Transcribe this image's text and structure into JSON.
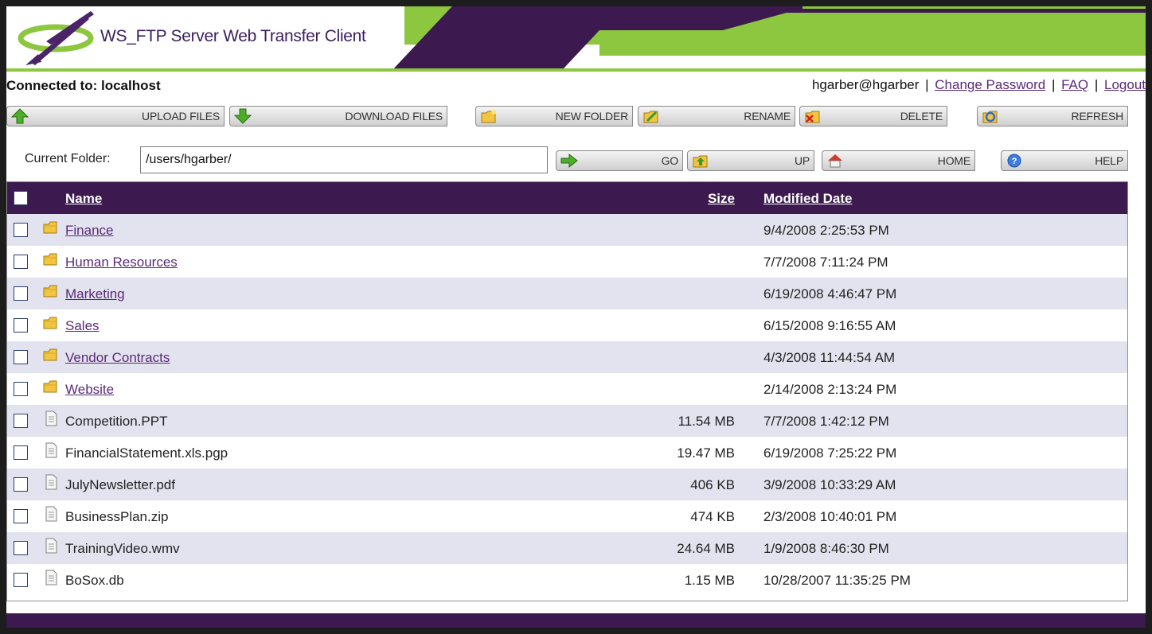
{
  "header": {
    "app_title": "WS_FTP Server Web Transfer Client",
    "colors": {
      "purple": "#3c1a4f",
      "green": "#8dc63f"
    }
  },
  "status": {
    "connected": "Connected to: localhost",
    "user": "hgarber@hgarber",
    "separator": "|",
    "change_password": "Change Password",
    "faq": "FAQ",
    "logout": "Logout"
  },
  "toolbar": {
    "upload": {
      "label": "UPLOAD FILES",
      "icon": "green-up-arrow-icon"
    },
    "download": {
      "label": "DOWNLOAD FILES",
      "icon": "green-down-arrow-icon"
    },
    "new_folder": {
      "label": "NEW FOLDER",
      "icon": "new-folder-icon"
    },
    "rename": {
      "label": "RENAME",
      "icon": "rename-icon"
    },
    "delete": {
      "label": "DELETE",
      "icon": "delete-icon"
    },
    "refresh": {
      "label": "REFRESH",
      "icon": "refresh-icon"
    }
  },
  "navbar": {
    "current_folder_label": "Current Folder:",
    "current_folder_value": "/users/hgarber/",
    "go": {
      "label": "GO",
      "icon": "green-right-arrow-icon"
    },
    "up": {
      "label": "UP",
      "icon": "up-folder-icon"
    },
    "home": {
      "label": "HOME",
      "icon": "home-icon"
    },
    "help": {
      "label": "HELP",
      "icon": "help-icon"
    }
  },
  "table": {
    "columns": {
      "name": "Name",
      "size": "Size",
      "modified": "Modified Date"
    },
    "rows": [
      {
        "type": "folder",
        "name": "Finance",
        "size": "",
        "modified": "9/4/2008 2:25:53 PM"
      },
      {
        "type": "folder",
        "name": "Human Resources",
        "size": "",
        "modified": "7/7/2008 7:11:24 PM"
      },
      {
        "type": "folder",
        "name": "Marketing",
        "size": "",
        "modified": "6/19/2008 4:46:47 PM"
      },
      {
        "type": "folder",
        "name": "Sales",
        "size": "",
        "modified": "6/15/2008 9:16:55 AM"
      },
      {
        "type": "folder",
        "name": "Vendor Contracts",
        "size": "",
        "modified": "4/3/2008 11:44:54 AM"
      },
      {
        "type": "folder",
        "name": "Website",
        "size": "",
        "modified": "2/14/2008 2:13:24 PM"
      },
      {
        "type": "file",
        "name": "Competition.PPT",
        "size": "11.54 MB",
        "modified": "7/7/2008 1:42:12 PM"
      },
      {
        "type": "file",
        "name": "FinancialStatement.xls.pgp",
        "size": "19.47 MB",
        "modified": "6/19/2008 7:25:22 PM"
      },
      {
        "type": "file",
        "name": "JulyNewsletter.pdf",
        "size": "406 KB",
        "modified": "3/9/2008 10:33:29 AM"
      },
      {
        "type": "file",
        "name": "BusinessPlan.zip",
        "size": "474 KB",
        "modified": "2/3/2008 10:40:01 PM"
      },
      {
        "type": "file",
        "name": "TrainingVideo.wmv",
        "size": "24.64 MB",
        "modified": "1/9/2008 8:46:30 PM"
      },
      {
        "type": "file",
        "name": "BoSox.db",
        "size": "1.15 MB",
        "modified": "10/28/2007 11:35:25 PM"
      }
    ]
  }
}
